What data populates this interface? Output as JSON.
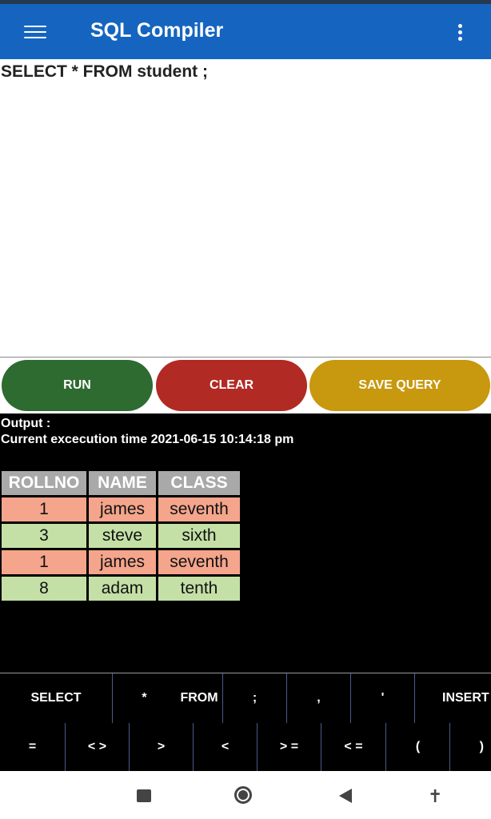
{
  "app": {
    "title": "SQL Compiler"
  },
  "colors": {
    "appbar": "#1565c0",
    "run": "#2e6b30",
    "clear": "#b22a24",
    "save": "#c8980e",
    "row_odd": "#f4a58c",
    "row_even": "#c4e0a6",
    "header": "#a9a9a9"
  },
  "editor": {
    "query": "SELECT * FROM student ;"
  },
  "buttons": {
    "run": "RUN",
    "clear": "CLEAR",
    "save": "SAVE QUERY"
  },
  "output": {
    "label": "Output :",
    "time": "Current excecution time 2021-06-15 10:14:18 pm",
    "columns": [
      "ROLLNO",
      "NAME",
      "CLASS"
    ],
    "rows": [
      [
        "1",
        "james",
        "seventh"
      ],
      [
        "3",
        "steve",
        "sixth"
      ],
      [
        "1",
        "james",
        "seventh"
      ],
      [
        "8",
        "adam",
        "tenth"
      ]
    ]
  },
  "keyboard": {
    "row1": [
      "SELECT",
      "*",
      "FROM",
      ";",
      ",",
      "'",
      "INSERT"
    ],
    "row2": [
      "=",
      "< >",
      ">",
      "<",
      "> =",
      "< =",
      "(",
      ")"
    ]
  },
  "navbar": {
    "icons": [
      "recents-icon",
      "home-icon",
      "back-icon",
      "accessibility-icon"
    ]
  }
}
